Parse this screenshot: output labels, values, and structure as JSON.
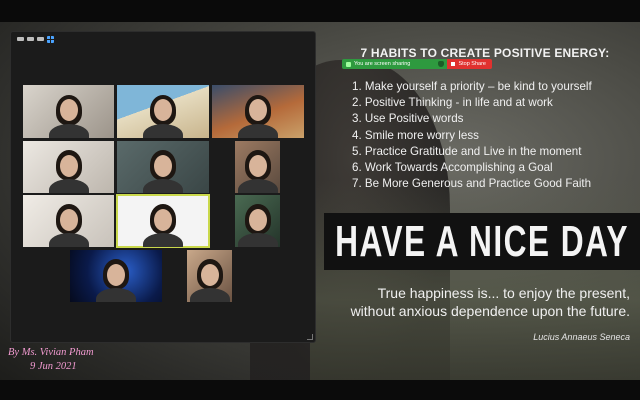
{
  "slide": {
    "title": "7 HABITS TO CREATE POSITIVE ENERGY:",
    "habits": [
      "1.  Make yourself a priority – be kind to yourself",
      "2.  Positive Thinking - in life and at work",
      "3.  Use Positive words",
      "4.  Smile more worry less",
      "5.  Practice Gratitude and Live in the moment",
      "6.  Work Towards Accomplishing a Goal",
      "7.  Be More Generous and Practice Good Faith"
    ],
    "banner": "HAVE A NICE DAY",
    "quote_line1": "True happiness is... to enjoy the present,",
    "quote_line2": "without anxious dependence upon the future.",
    "quote_author": "Lucius Annaeus Seneca",
    "credit_name": "By Ms. Vivian Pham",
    "credit_date": "9 Jun 2021"
  },
  "share_bar": {
    "status": "You are screen sharing",
    "stop_label": "Stop Share",
    "color_bar": "#2e9a3f",
    "color_stop": "#e0312f"
  },
  "zoom_window": {
    "toolbar_icons": [
      "minimize-icon",
      "restore-icon",
      "fullscreen-icon",
      "gallery-view-icon"
    ],
    "tiles": [
      {
        "id": "t1"
      },
      {
        "id": "t2"
      },
      {
        "id": "t3"
      },
      {
        "id": "t4"
      },
      {
        "id": "t5"
      },
      {
        "id": "t6"
      },
      {
        "id": "t7"
      },
      {
        "id": "t8",
        "active_speaker": true
      },
      {
        "id": "t9"
      },
      {
        "id": "t10"
      },
      {
        "id": "t11"
      }
    ],
    "active_speaker_color": "#c9d84b"
  }
}
